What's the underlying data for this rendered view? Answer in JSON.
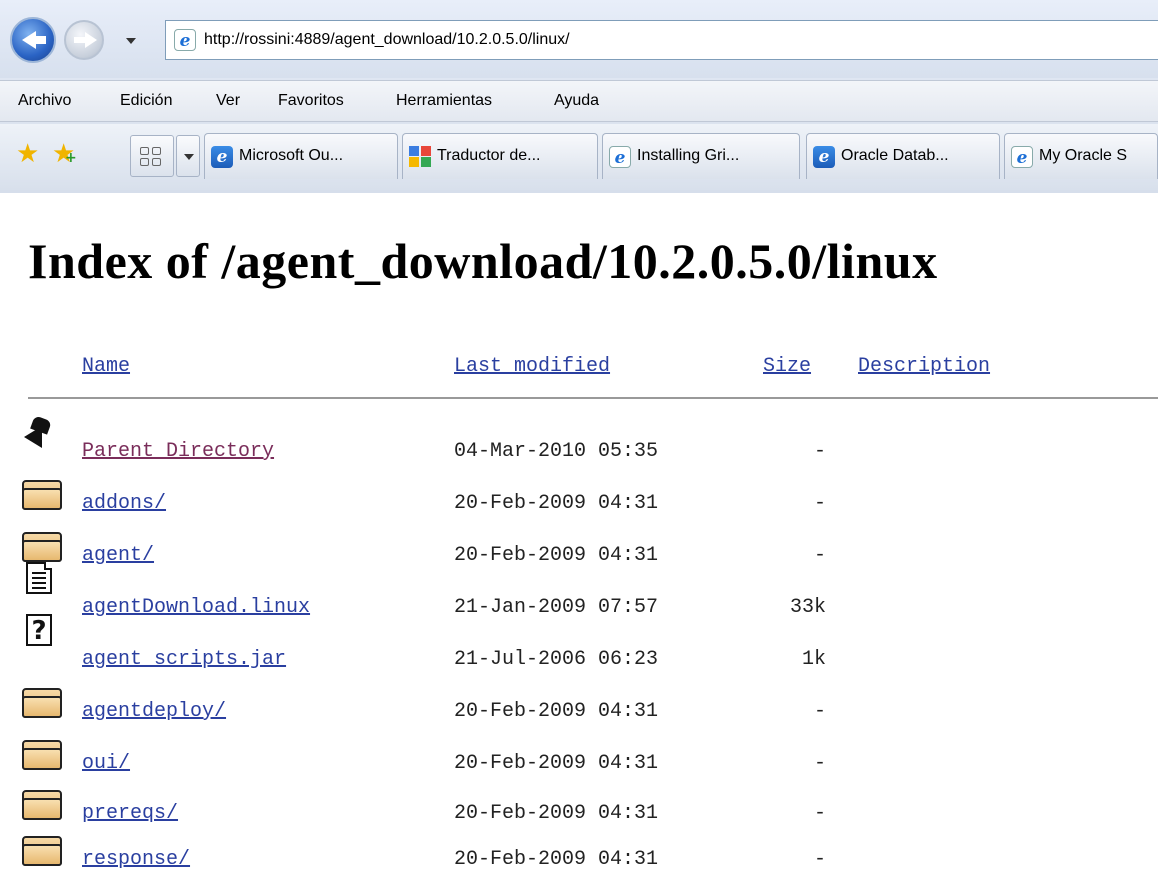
{
  "browser": {
    "address": "http://rossini:4889/agent_download/10.2.0.5.0/linux/",
    "menu": [
      "Archivo",
      "Edición",
      "Ver",
      "Favoritos",
      "Herramientas",
      "Ayuda"
    ],
    "tabs": [
      {
        "label": "Microsoft Ou...",
        "icon": "ie-icon"
      },
      {
        "label": "Traductor de...",
        "icon": "google-translate-icon"
      },
      {
        "label": "Installing Gri...",
        "icon": "ie-icon"
      },
      {
        "label": "Oracle Datab...",
        "icon": "ie-icon"
      },
      {
        "label": "My Oracle S",
        "icon": "ie-icon"
      }
    ]
  },
  "page": {
    "title": "Index of /agent_download/10.2.0.5.0/linux",
    "columns": {
      "name": "Name",
      "modified": "Last modified",
      "size": "Size",
      "description": "Description"
    },
    "rows": [
      {
        "icon": "parent-directory-icon",
        "name": "Parent Directory",
        "modified": "04-Mar-2010 05:35",
        "size": "-"
      },
      {
        "icon": "folder-icon",
        "name": "addons/",
        "modified": "20-Feb-2009 04:31",
        "size": "-"
      },
      {
        "icon": "folder-icon",
        "name": "agent/",
        "modified": "20-Feb-2009 04:31",
        "size": "-"
      },
      {
        "icon": "text-file-icon",
        "name": "agentDownload.linux",
        "modified": "21-Jan-2009 07:57",
        "size": "33k"
      },
      {
        "icon": "unknown-file-icon",
        "name": "agent_scripts.jar",
        "modified": "21-Jul-2006 06:23",
        "size": "1k"
      },
      {
        "icon": "folder-icon",
        "name": "agentdeploy/",
        "modified": "20-Feb-2009 04:31",
        "size": "-"
      },
      {
        "icon": "folder-icon",
        "name": "oui/",
        "modified": "20-Feb-2009 04:31",
        "size": "-"
      },
      {
        "icon": "folder-icon",
        "name": "prereqs/",
        "modified": "20-Feb-2009 04:31",
        "size": "-"
      },
      {
        "icon": "folder-icon",
        "name": "response/",
        "modified": "20-Feb-2009 04:31",
        "size": "-"
      }
    ]
  }
}
